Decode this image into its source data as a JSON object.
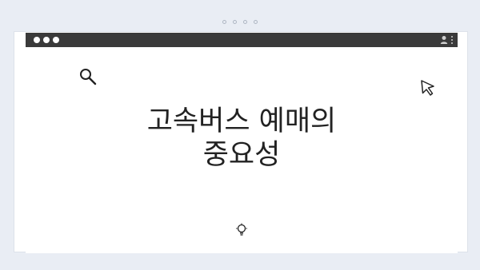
{
  "window": {
    "heading_line_1": "고속버스 예매의",
    "heading_line_2": "중요성"
  },
  "icons": {
    "search": "search-icon",
    "cursor": "cursor-icon",
    "user": "user-icon",
    "menu": "kebab-menu-icon",
    "bottom": "lightbulb-icon"
  },
  "colors": {
    "background": "#e9edf4",
    "titlebar": "#3a3a3a",
    "window": "#ffffff",
    "text": "#222222"
  }
}
